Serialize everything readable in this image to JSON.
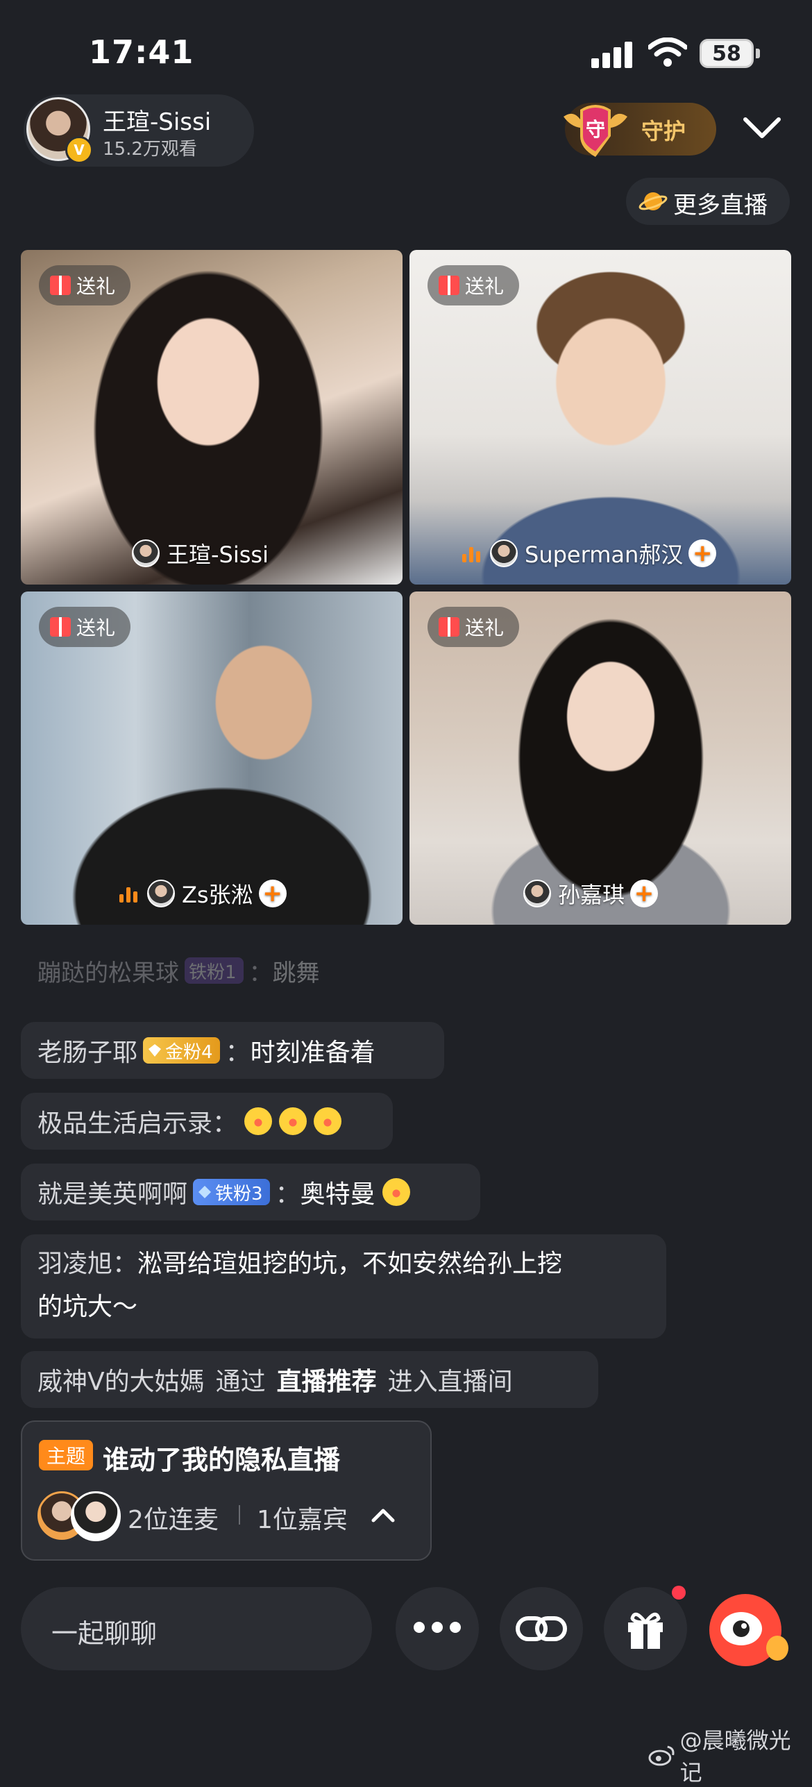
{
  "status": {
    "time": "17:41",
    "battery": "58"
  },
  "host": {
    "name": "王瑄-Sissi",
    "views": "15.2万观看",
    "verified_badge": "V"
  },
  "guard_label": "守护",
  "guard_shield_char": "守",
  "more_live_label": "更多直播",
  "tiles": [
    {
      "gift_label": "送礼",
      "name": "王瑄-Sissi",
      "speaking": false,
      "follow": false
    },
    {
      "gift_label": "送礼",
      "name": "Superman郝汉",
      "speaking": true,
      "follow": true
    },
    {
      "gift_label": "送礼",
      "name": "Zs张淞",
      "speaking": true,
      "follow": true
    },
    {
      "gift_label": "送礼",
      "name": "孙嘉琪",
      "speaking": false,
      "follow": true
    }
  ],
  "follow_symbol": "+",
  "chat": {
    "partial": {
      "who": "蹦跶的松果球",
      "badge": "铁粉1",
      "sep": "：",
      "msg": "跳舞"
    },
    "messages": [
      {
        "who": "老肠子耶",
        "badge": "金粉4",
        "sep": "：",
        "msg": "时刻准备着"
      },
      {
        "who": "极品生活启示录",
        "sep": "："
      },
      {
        "who": "就是美英啊啊",
        "badge": "铁粉3",
        "sep": "：",
        "msg": "奥特曼"
      },
      {
        "who": "羽凌旭",
        "sep": "：",
        "msg_line1": "淞哥给瑄姐挖的坑，不如安然给孙上挖",
        "msg_line2": "的坑大～"
      },
      {
        "who": "威神V的大姑媽",
        "via": "通过",
        "source": "直播推荐",
        "action": "进入直播间"
      }
    ]
  },
  "topic": {
    "tag": "主题",
    "title": "谁动了我的隐私直播",
    "linked": "2位连麦",
    "guests": "1位嘉宾"
  },
  "bottom": {
    "input_placeholder": "一起聊聊"
  },
  "watermark": "@晨曦微光记",
  "colors": {
    "accent_orange": "#ff8a1a",
    "background": "#1f2126",
    "bubble": "#2b2d33",
    "gold_badge": "#f6c54a",
    "iron_badge": "#4a7ee6"
  }
}
